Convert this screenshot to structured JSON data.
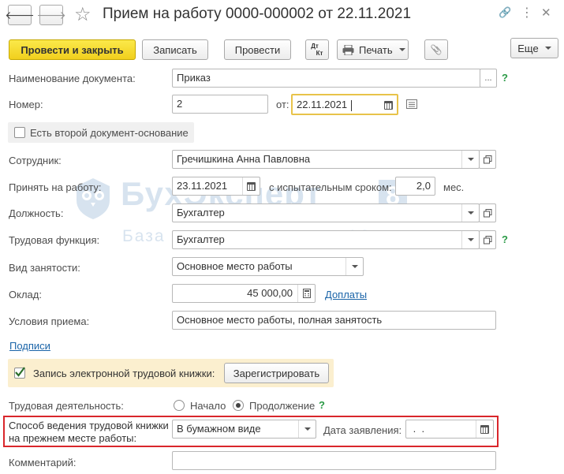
{
  "window": {
    "title": "Прием на работу 0000-000002 от 22.11.2021",
    "back_glyph": "🡐",
    "forward_glyph": "🡒",
    "star_glyph": "☆",
    "link_glyph": "🔗",
    "more_glyph": "⋮",
    "close_glyph": "✕"
  },
  "toolbar": {
    "post_close": "Провести и закрыть",
    "save": "Записать",
    "post": "Провести",
    "dtkt_top": "Дт",
    "dtkt_bottom": "Кт",
    "print": "Печать",
    "attach_glyph": "📎",
    "more": "Еще"
  },
  "form": {
    "doc_name_label": "Наименование документа:",
    "doc_name_value": "Приказ",
    "doc_name_btn": "...",
    "number_label": "Номер:",
    "number_value": "2",
    "from_label": "от:",
    "date_value": "22.11.2021",
    "second_doc_label": "Есть второй документ-основание",
    "employee_label": "Сотрудник:",
    "employee_value": "Гречишкина Анна Павловна",
    "hire_label": "Принять на работу:",
    "hire_date": "23.11.2021",
    "trial_label": "с испытательным сроком:",
    "trial_value": "2,0",
    "trial_unit": "мес.",
    "position_label": "Должность:",
    "position_value": "Бухгалтер",
    "labor_func_label": "Трудовая функция:",
    "labor_func_value": "Бухгалтер",
    "employment_label": "Вид занятости:",
    "employment_value": "Основное место работы",
    "salary_label": "Оклад:",
    "salary_value": "45 000,00",
    "extra_link": "Доплаты",
    "conditions_label": "Условия приема:",
    "conditions_value": "Основное место работы, полная занятость",
    "signatures_link": "Подписи",
    "etk_label": "Запись электронной трудовой книжки:",
    "register_button": "Зарегистрировать",
    "activity_label": "Трудовая деятельность:",
    "activity_start": "Начало",
    "activity_continue": "Продолжение",
    "book_method_label_1": "Способ ведения трудовой книжки",
    "book_method_label_2": "на прежнем месте работы:",
    "book_method_value": "В бумажном виде",
    "application_date_label": "Дата заявления:",
    "application_date_value": " .  .",
    "comment_label": "Комментарий:",
    "comment_value": "",
    "help_glyph": "?"
  },
  "watermark": {
    "title": "БухЭксперт",
    "badge": "8",
    "subtitle": "База ответов по учету в 1С"
  },
  "colors": {
    "primary_button": "#f5d52a",
    "link": "#1a64a8",
    "help": "#2a9a46",
    "highlight_box": "#d9262b",
    "etk_panel": "#fbefcf",
    "date_focus": "#e8c34a"
  }
}
